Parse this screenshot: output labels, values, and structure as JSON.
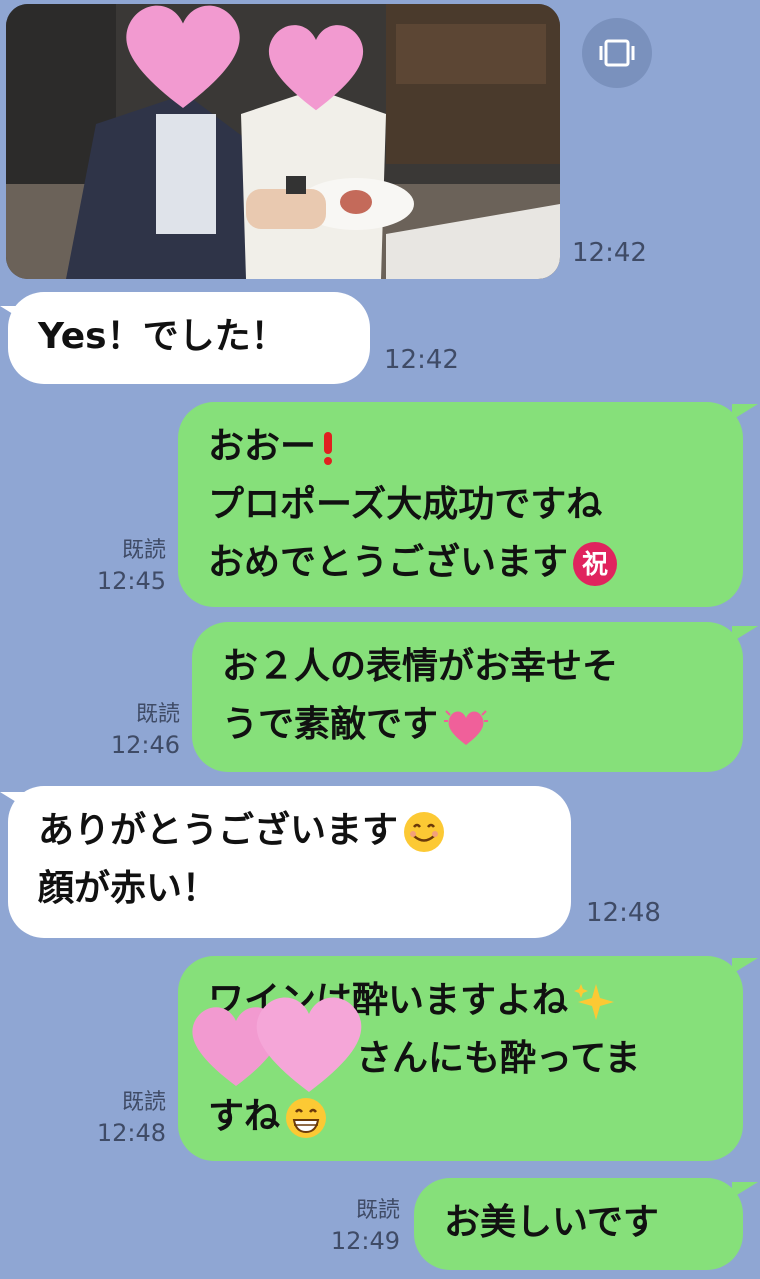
{
  "messages": [
    {
      "type": "image",
      "time": "12:42"
    },
    {
      "type": "text",
      "lines": [
        "Yes！でした！"
      ],
      "time": "12:42"
    },
    {
      "type": "text",
      "lines": [
        "おおー",
        "プロポーズ大成功ですね",
        "おめでとうございます"
      ],
      "read": "既読",
      "time": "12:45"
    },
    {
      "type": "text",
      "lines": [
        "お２人の表情がお幸せそ",
        "うで素敵です"
      ],
      "read": "既読",
      "time": "12:46"
    },
    {
      "type": "text",
      "lines": [
        "ありがとうございます",
        "顔が赤い！"
      ],
      "time": "12:48"
    },
    {
      "type": "text",
      "lines": [
        "ワインは酔いますよね",
        "さんにも酔ってま",
        "すね"
      ],
      "read": "既読",
      "time": "12:48"
    },
    {
      "type": "text",
      "lines": [
        "お美しいです"
      ],
      "read": "既読",
      "time": "12:49"
    }
  ],
  "icons": [
    "expand-icon",
    "exclamation-emoji",
    "celebration-emoji",
    "beating-heart-emoji",
    "smiling-face-emoji",
    "sparkles-emoji",
    "grinning-face-emoji",
    "heart-sticker"
  ],
  "colors": {
    "background": "#8fa6d3",
    "sent_bubble": "#86e07a",
    "received_bubble": "#ffffff"
  }
}
